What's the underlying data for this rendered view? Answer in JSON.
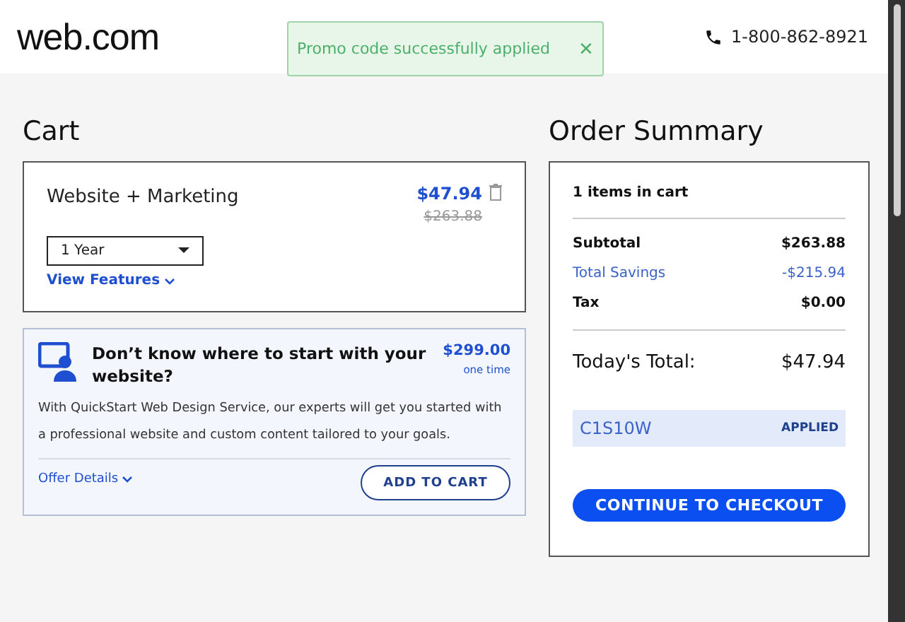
{
  "header": {
    "logo": "web.com",
    "phone": "1-800-862-8921"
  },
  "toast": {
    "message": "Promo code successfully applied",
    "close": "✕"
  },
  "cart": {
    "title": "Cart",
    "item": {
      "name": "Website + Marketing",
      "price": "$47.94",
      "old_price": "$263.88",
      "term": "1 Year",
      "features_link": "View Features"
    },
    "offer": {
      "title": "Don’t know where to start with your website?",
      "price": "$299.00",
      "price_note": "one time",
      "description": "With QuickStart Web Design Service, our experts will get you started with a professional website and custom content tailored to your goals.",
      "details_link": "Offer Details",
      "button": "ADD TO CART"
    }
  },
  "summary": {
    "title": "Order Summary",
    "count": "1 items in cart",
    "rows": [
      {
        "label": "Subtotal",
        "value": "$263.88",
        "kind": "normal"
      },
      {
        "label": "Total Savings",
        "value": "-$215.94",
        "kind": "savings"
      },
      {
        "label": "Tax",
        "value": "$0.00",
        "kind": "normal"
      }
    ],
    "total_label": "Today's Total:",
    "total_value": "$47.94",
    "promo": {
      "code": "C1S10W",
      "status": "APPLIED"
    },
    "checkout": "CONTINUE TO CHECKOUT"
  }
}
